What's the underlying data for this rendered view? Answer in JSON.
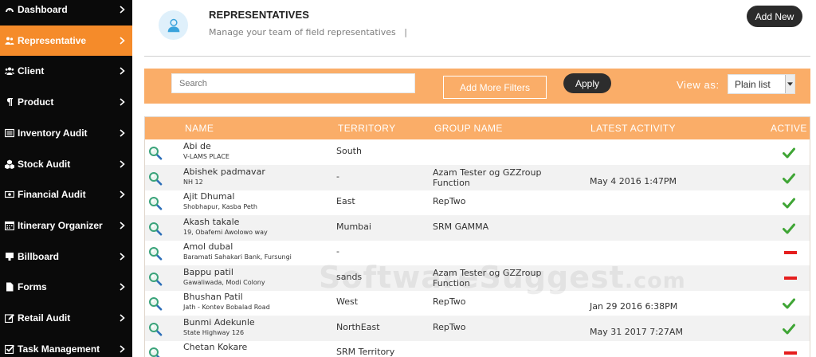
{
  "sidebar": {
    "items": [
      {
        "label": "Dashboard",
        "icon": "dashboard-icon",
        "active": false
      },
      {
        "label": "Representative",
        "icon": "users-icon",
        "active": true
      },
      {
        "label": "Client",
        "icon": "group-icon",
        "active": false
      },
      {
        "label": "Product",
        "icon": "paragraph-icon",
        "active": false
      },
      {
        "label": "Inventory Audit",
        "icon": "list-icon",
        "active": false
      },
      {
        "label": "Stock Audit",
        "icon": "cubes-icon",
        "active": false
      },
      {
        "label": "Financial Audit",
        "icon": "money-icon",
        "active": false
      },
      {
        "label": "Itinerary Organizer",
        "icon": "calendar-icon",
        "active": false
      },
      {
        "label": "Billboard",
        "icon": "billboard-icon",
        "active": false
      },
      {
        "label": "Forms",
        "icon": "file-icon",
        "active": false
      },
      {
        "label": "Retail Audit",
        "icon": "edit-icon",
        "active": false
      },
      {
        "label": "Task Management",
        "icon": "checkbox-icon",
        "active": false
      }
    ]
  },
  "header": {
    "title": "REPRESENTATIVES",
    "subtitle": "Manage your team of field representatives   |",
    "add_new_label": "Add New",
    "icon": "user-avatar-icon"
  },
  "filters": {
    "search_placeholder": "Search",
    "more_filters_label": "Add More Filters",
    "apply_label": "Apply",
    "view_as_label": "View as:",
    "view_as_value": "Plain list"
  },
  "table": {
    "columns": [
      "NAME",
      "TERRITORY",
      "GROUP NAME",
      "LATEST ACTIVITY",
      "ACTIVE"
    ],
    "rows": [
      {
        "name": "Abi de",
        "address": "V-LAMS PLACE",
        "territory": "South",
        "group": "",
        "activity": "",
        "active": true
      },
      {
        "name": "Abishek padmavar",
        "address": "NH 12",
        "territory": "-",
        "group": "Azam Tester og GZZroup Function",
        "activity": "May 4 2016 1:47PM",
        "active": true
      },
      {
        "name": "Ajit Dhumal",
        "address": "Shobhapur, Kasba Peth",
        "territory": "East",
        "group": "RepTwo",
        "activity": "",
        "active": true
      },
      {
        "name": "Akash takale",
        "address": "19, Obafemi Awolowo way",
        "territory": "Mumbai",
        "group": "SRM GAMMA",
        "activity": "",
        "active": true
      },
      {
        "name": "Amol dubal",
        "address": "Baramati Sahakari Bank, Fursungi",
        "territory": "-",
        "group": "",
        "activity": "",
        "active": false
      },
      {
        "name": "Bappu patil",
        "address": "Gawaliwada, Modi Colony",
        "territory": "sands",
        "group": "Azam Tester og GZZroup Function",
        "activity": "",
        "active": false
      },
      {
        "name": "Bhushan Patil",
        "address": "Jath - Kontev Bobalad Road",
        "territory": "West",
        "group": "RepTwo",
        "activity": "Jan 29 2016 6:38PM",
        "active": true
      },
      {
        "name": "Bunmi Adekunle",
        "address": "State Highway 126",
        "territory": "NorthEast",
        "group": "RepTwo",
        "activity": "May 31 2017 7:27AM",
        "active": true
      },
      {
        "name": "Chetan Kokare",
        "address": "",
        "territory": "SRM  Territory",
        "group": "",
        "activity": "",
        "active": false
      }
    ]
  },
  "watermark": {
    "main": "SoftwareSuggest",
    "suffix": ".com"
  },
  "colors": {
    "accent": "#f58b2a",
    "header_bar": "#faad68",
    "sidebar_bg": "#0a0a0a",
    "check": "#3fa535",
    "inactive": "#e51e1e"
  }
}
